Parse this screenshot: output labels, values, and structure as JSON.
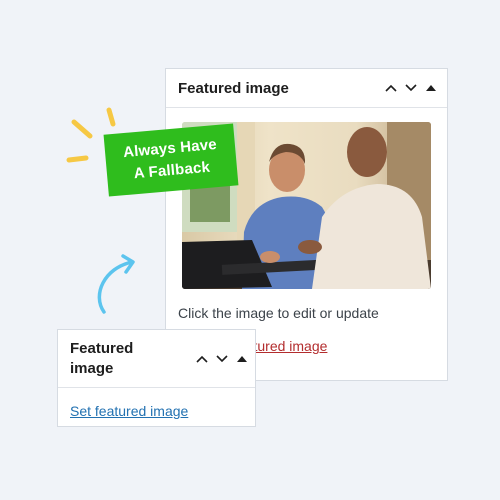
{
  "main_panel": {
    "title": "Featured image",
    "caption": "Click the image to edit or update",
    "remove_link": "Remove featured image",
    "image_alt": "Two men looking at a laptop"
  },
  "small_panel": {
    "title": "Featured image",
    "set_link": "Set featured image"
  },
  "badge": {
    "line1": "Always Have",
    "line2": "A Fallback"
  },
  "colors": {
    "background": "#f0f3f8",
    "badge_green": "#2fbd1d",
    "spark_yellow": "#f6c844",
    "arrow_blue": "#5cc4ee",
    "remove_link_red": "#b32d2e",
    "set_link_blue": "#2271b1"
  },
  "icons": {
    "move_up": "chevron-up-icon",
    "move_down": "chevron-down-icon",
    "toggle": "caret-up-icon"
  }
}
